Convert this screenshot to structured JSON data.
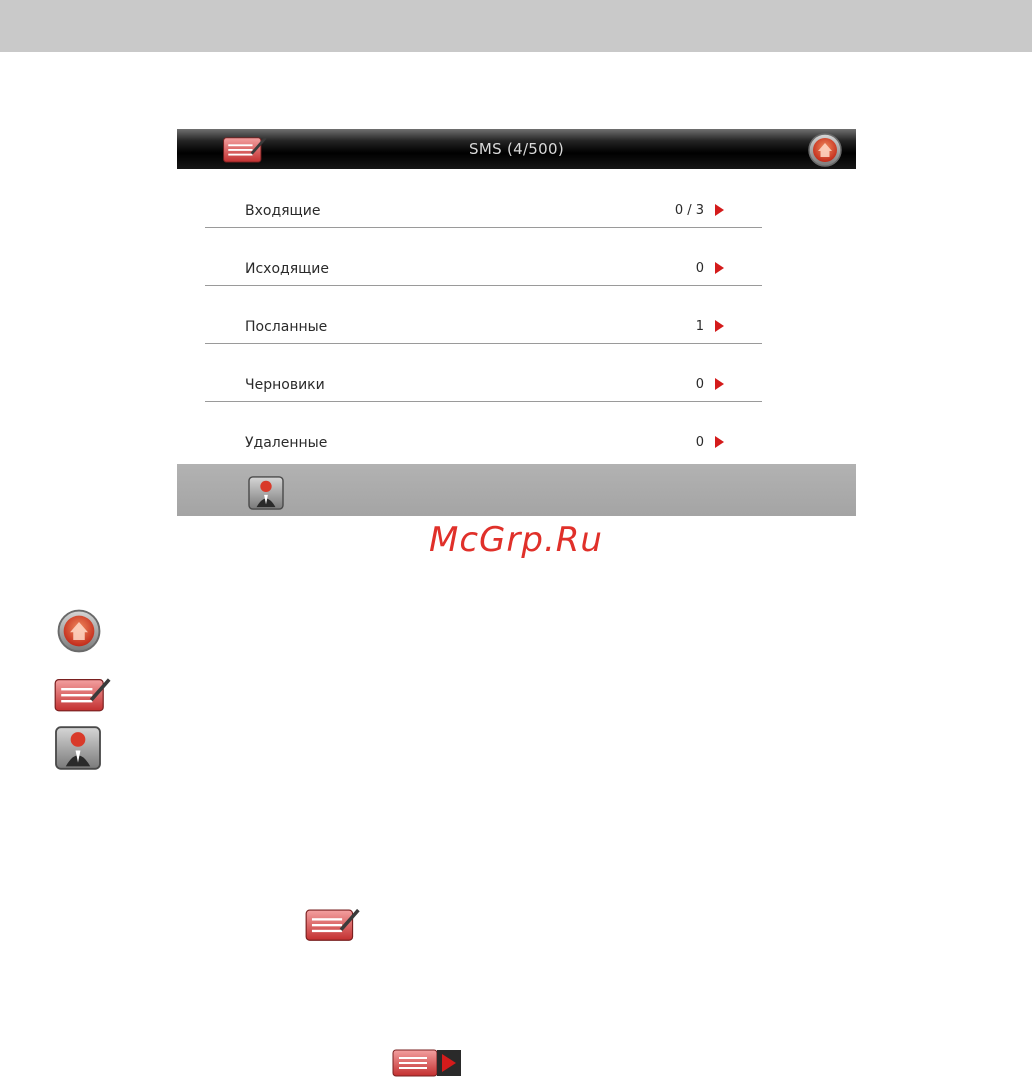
{
  "screen": {
    "title": "SMS (4/500)",
    "rows": [
      {
        "label": "Входящие",
        "count": "0 / 3"
      },
      {
        "label": "Исходящие",
        "count": "0"
      },
      {
        "label": "Посланные",
        "count": "1"
      },
      {
        "label": "Черновики",
        "count": "0"
      },
      {
        "label": "Удаленные",
        "count": "0"
      }
    ]
  },
  "watermark": "McGrp.Ru",
  "icons": {
    "compose": "compose-message-icon",
    "home": "home-icon",
    "contacts": "contacts-person-icon",
    "list_arrow": "list-next-icon"
  },
  "colors": {
    "accent_red": "#d41b1b",
    "titlebar": "#000000",
    "bottombar": "#a8a8a8",
    "top_band": "#c9c9c9",
    "watermark": "#e0302a"
  }
}
